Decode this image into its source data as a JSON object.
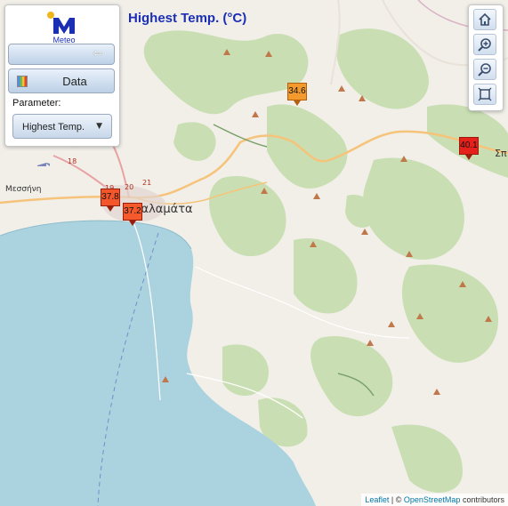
{
  "title": "Highest Temp. (°C)",
  "logo": {
    "text": "Meteo"
  },
  "panel": {
    "data_button": "Data",
    "parameter_label": "Parameter:",
    "parameter_selected": "Highest Temp."
  },
  "toolbar": {
    "icons": [
      "home-icon",
      "zoom-in-icon",
      "zoom-out-icon",
      "fit-extent-icon"
    ]
  },
  "markers": [
    {
      "value": "34.6",
      "color": "#f29a2e"
    },
    {
      "value": "40.1",
      "color": "#e6201b"
    },
    {
      "value": "37.8",
      "color": "#f3562a"
    },
    {
      "value": "37.2",
      "color": "#f45a2b"
    }
  ],
  "places": {
    "city": "Καλαμάτα",
    "village": "Μεσσήνη",
    "town_east": "Σπ",
    "road_labels": [
      "18",
      "19",
      "20",
      "21"
    ]
  },
  "attribution": {
    "leaflet": "Leaflet",
    "sep": "| ©",
    "osm": "OpenStreetMap",
    "suffix": "contributors"
  },
  "colors": {
    "sea": "#aad3df",
    "land": "#f2efe9",
    "forest": "#c8dfb2",
    "title": "#1b2fb5"
  }
}
